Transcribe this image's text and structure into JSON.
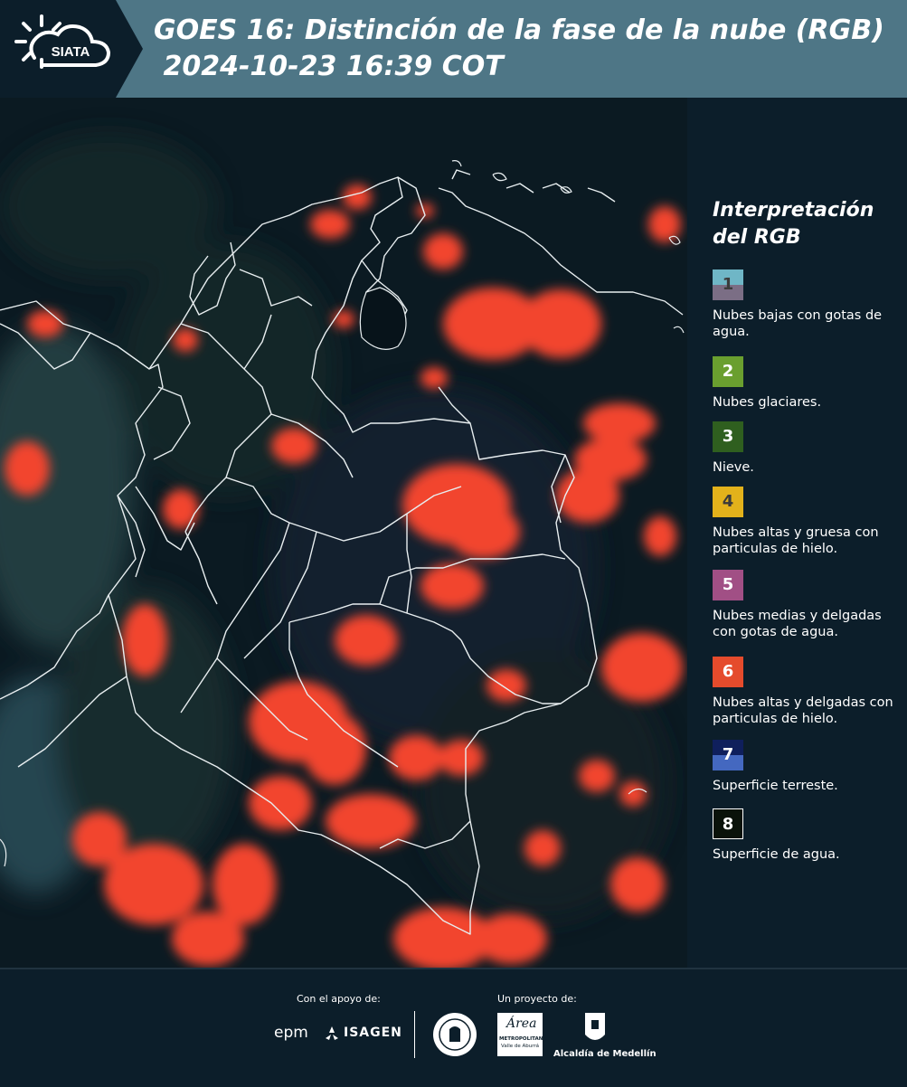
{
  "header": {
    "title_line1": "GOES 16: Distinción de la fase de la nube (RGB)",
    "title_line2": " 2024-10-23 16:39 COT",
    "logo_text": "SIATA",
    "bg_color": "#4e7686"
  },
  "legend": {
    "title": "Interpretación del RGB",
    "items": [
      {
        "number": "1",
        "label": "Nubes bajas con gotas de agua.",
        "color": "#6fb6c6"
      },
      {
        "number": "2",
        "label": "Nubes glaciares.",
        "color": "#6a9f2f"
      },
      {
        "number": "3",
        "label": "Nieve.",
        "color": "#2f5f1f"
      },
      {
        "number": "4",
        "label": "Nubes altas y gruesa con particulas de hielo.",
        "color": "#e3b21b"
      },
      {
        "number": "5",
        "label": "Nubes medias y delgadas con gotas de agua.",
        "color": "#a14f85"
      },
      {
        "number": "6",
        "label": "Nubes altas y delgadas con particulas de hielo.",
        "color": "#e54b2c"
      },
      {
        "number": "7",
        "label": "Superficie terreste.",
        "color": "#1c3b8e"
      },
      {
        "number": "8",
        "label": "Superficie de agua.",
        "color": "#0a120a"
      }
    ]
  },
  "footer": {
    "support_label": "Con el apoyo de:",
    "project_label": "Un proyecto de:",
    "sponsor1": "epm",
    "sponsor2": "ISAGEN",
    "partner_area_line1": "Área",
    "partner_area_line2": "METROPOLITANA",
    "partner_area_line3": "Valle de Aburrá",
    "partner_city": "Alcaldía de Medellín"
  }
}
